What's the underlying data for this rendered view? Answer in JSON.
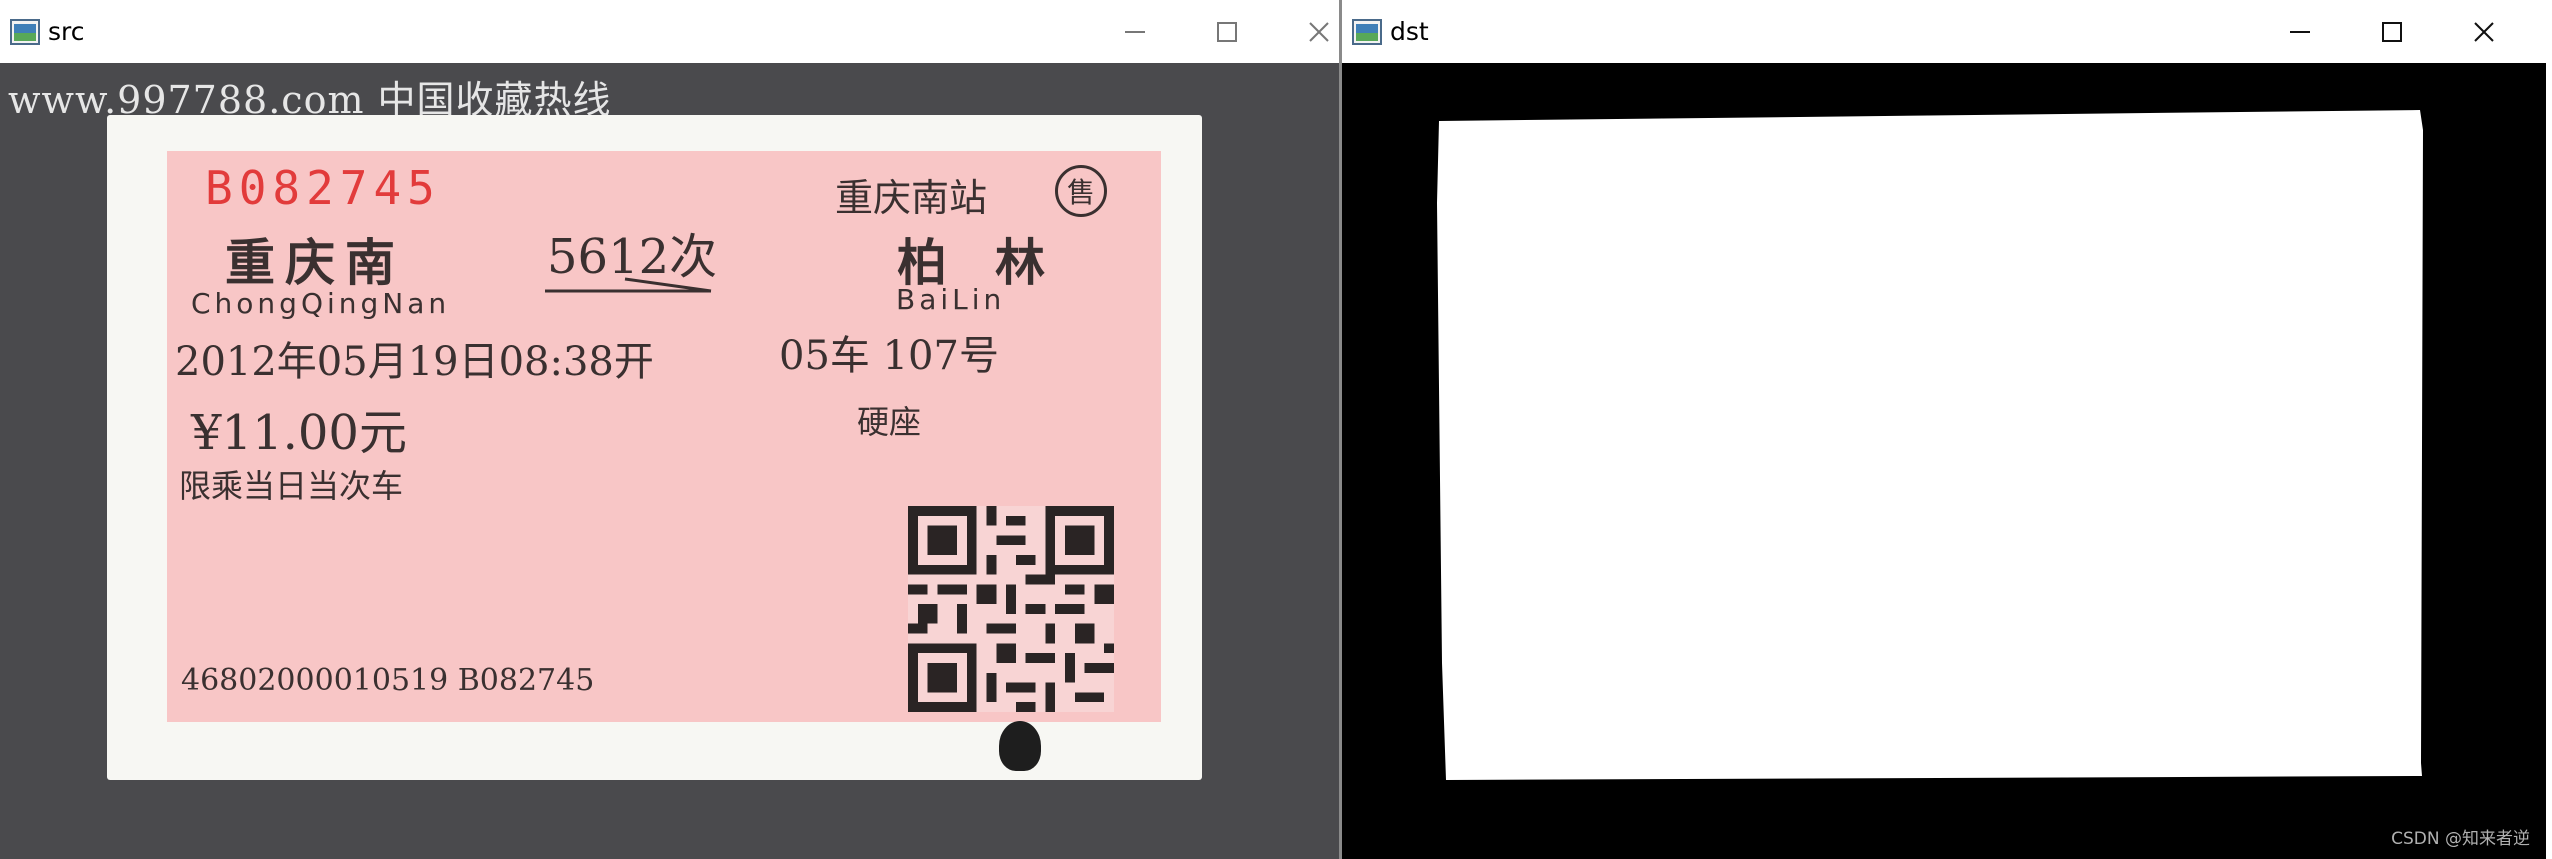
{
  "windows": {
    "src": {
      "title": "src",
      "watermark": "www.997788.com 中国收藏热线",
      "ticket": {
        "serial_top": "B082745",
        "departure_station_top": "重庆南站",
        "sale_stamp": "售",
        "from_station": "重庆南",
        "train_no": "5612次",
        "to_station": "柏林",
        "from_pinyin": "ChongQingNan",
        "to_pinyin": "BaiLin",
        "datetime": "2012年05月19日08:38开",
        "car_seat": "05车 107号",
        "price": "¥11.00元",
        "seat_type": "硬座",
        "restriction": "限乘当日当次车",
        "bottom_number": "46802000010519 B082745"
      }
    },
    "dst": {
      "title": "dst"
    }
  },
  "footer": {
    "credit": "CSDN @知来者逆"
  },
  "colors": {
    "ticket_pink": "#f8c6c6",
    "serial_red": "#e23b3b",
    "src_background": "#4a4a4d",
    "dst_background": "#000000",
    "mask_white": "#ffffff"
  },
  "icons": {
    "app": "opencv-window-icon",
    "minimize": "minimize-icon",
    "maximize": "maximize-icon",
    "close": "close-icon"
  }
}
